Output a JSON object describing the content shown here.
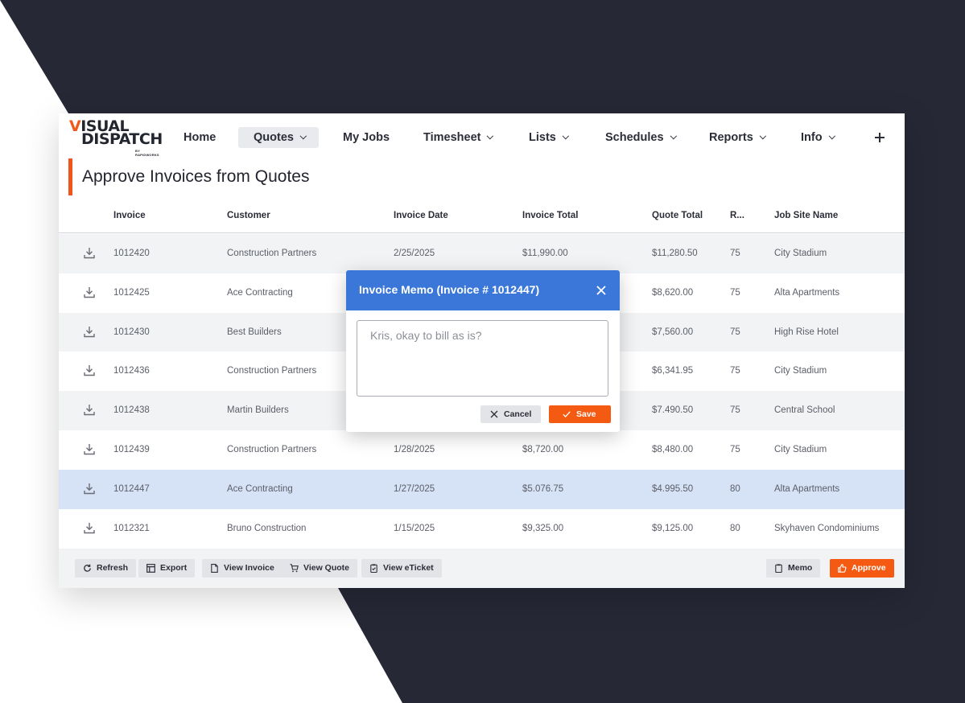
{
  "brand": {
    "line1_v": "V",
    "line1_rest": "ISUAL",
    "line2": "DISPATCH",
    "byline": "BY RAPIDWORKS"
  },
  "nav": {
    "home": "Home",
    "quotes": "Quotes",
    "my_jobs": "My Jobs",
    "timesheet": "Timesheet",
    "lists": "Lists",
    "schedules": "Schedules",
    "reports": "Reports",
    "info": "Info",
    "active": "Quotes"
  },
  "page": {
    "title": "Approve Invoices from Quotes"
  },
  "table": {
    "headers": {
      "invoice": "Invoice",
      "customer": "Customer",
      "invoice_date": "Invoice Date",
      "invoice_total": "Invoice Total",
      "quote_total": "Quote Total",
      "r": "R...",
      "job_site": "Job Site Name"
    },
    "rows": [
      {
        "invoice": "1012420",
        "customer": "Construction Partners",
        "date": "2/25/2025",
        "invoice_total": "$11,990.00",
        "quote_total": "$11,280.50",
        "r": "75",
        "site": "City Stadium"
      },
      {
        "invoice": "1012425",
        "customer": "Ace Contracting",
        "date": "",
        "invoice_total": "",
        "quote_total": "$8,620.00",
        "r": "75",
        "site": "Alta Apartments"
      },
      {
        "invoice": "1012430",
        "customer": "Best Builders",
        "date": "",
        "invoice_total": "",
        "quote_total": "$7,560.00",
        "r": "75",
        "site": "High Rise Hotel"
      },
      {
        "invoice": "1012436",
        "customer": "Construction Partners",
        "date": "",
        "invoice_total": "",
        "quote_total": "$6,341.95",
        "r": "75",
        "site": "City Stadium"
      },
      {
        "invoice": "1012438",
        "customer": "Martin Builders",
        "date": "",
        "invoice_total": "",
        "quote_total": "$7.490.50",
        "r": "75",
        "site": "Central School"
      },
      {
        "invoice": "1012439",
        "customer": "Construction Partners",
        "date": "1/28/2025",
        "invoice_total": "$8,720.00",
        "quote_total": "$8,480.00",
        "r": "75",
        "site": "City Stadium"
      },
      {
        "invoice": "1012447",
        "customer": "Ace Contracting",
        "date": "1/27/2025",
        "invoice_total": "$5.076.75",
        "quote_total": "$4.995.50",
        "r": "80",
        "site": "Alta Apartments"
      },
      {
        "invoice": "1012321",
        "customer": "Bruno Construction",
        "date": "1/15/2025",
        "invoice_total": "$9,325.00",
        "quote_total": "$9,125.00",
        "r": "80",
        "site": "Skyhaven Condominiums"
      }
    ],
    "selected_invoice": "1012447"
  },
  "footer": {
    "refresh": "Refresh",
    "export": "Export",
    "view_invoice": "View Invoice",
    "view_quote": "View Quote",
    "view_eticket": "View eTicket",
    "memo": "Memo",
    "approve": "Approve"
  },
  "modal": {
    "title": "Invoice Memo (Invoice # 1012447)",
    "memo_text": "Kris, okay to bill as is?",
    "cancel": "Cancel",
    "save": "Save"
  },
  "colors": {
    "accent_orange": "#f55a12",
    "modal_header_blue": "#3a77d8",
    "selected_row": "#d6e2f5",
    "background_dark": "#262836"
  },
  "icons": {
    "row_action": "download-icon",
    "refresh": "refresh-icon",
    "export": "table-icon",
    "view_invoice": "document-icon",
    "view_quote": "cart-icon",
    "view_eticket": "clipboard-check-icon",
    "memo": "clipboard-icon",
    "approve": "thumbs-up-icon",
    "modal_close": "close-icon",
    "cancel": "close-icon",
    "save": "check-icon",
    "add": "plus-icon"
  }
}
